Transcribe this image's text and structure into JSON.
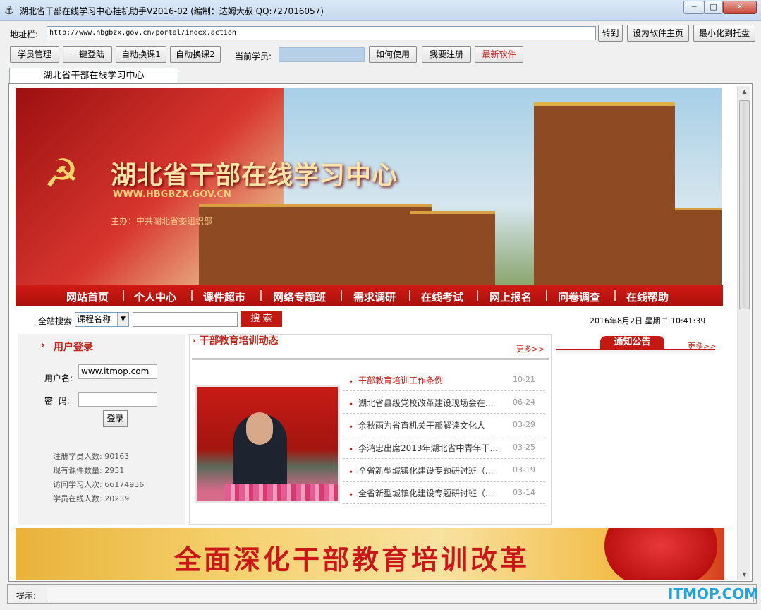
{
  "window": {
    "title": "湖北省干部在线学习中心挂机助手V2016-02 (编制：达姆大叔 QQ:727016057)",
    "minimize": "─",
    "maximize": "□",
    "close": "✕"
  },
  "toolbar": {
    "address_label": "地址栏:",
    "address_value": "http://www.hbgbzx.gov.cn/portal/index.action",
    "go_label": "转到",
    "set_home_label": "设为软件主页",
    "minimize_tray_label": "最小化到托盘",
    "student_mgmt_label": "学员管理",
    "one_click_login_label": "一键登陆",
    "auto_switch1_label": "自动换课1",
    "auto_switch2_label": "自动换课2",
    "current_student_label": "当前学员:",
    "how_to_use_label": "如何使用",
    "register_label": "我要注册",
    "latest_software_label": "最新软件"
  },
  "tab": {
    "label": "湖北省干部在线学习中心"
  },
  "site": {
    "banner": {
      "title": "湖北省干部在线学习中心",
      "url": "WWW.HBGBZX.GOV.CN",
      "sponsor": "主办：中共湖北省委组织部"
    },
    "nav": [
      "网站首页",
      "个人中心",
      "课件超市",
      "网络专题班",
      "需求调研",
      "在线考试",
      "网上报名",
      "问卷调查",
      "在线帮助"
    ],
    "search": {
      "label": "全站搜索",
      "select_value": "课程名称",
      "button": "搜 索"
    },
    "date": "2016年8月2日 星期二 10:41:39",
    "login": {
      "title": "用户登录",
      "username_label": "用户名:",
      "username_value": "www.itmop.com",
      "password_label": "密  码:",
      "submit": "登录"
    },
    "stats": [
      {
        "label": "注册学员人数:",
        "value": "90163"
      },
      {
        "label": "现有课件数量:",
        "value": "2931"
      },
      {
        "label": "访问学习人次:",
        "value": "66174936"
      },
      {
        "label": "学员在线人数:",
        "value": "20239"
      }
    ],
    "news": {
      "title": "干部教育培训动态",
      "more": "更多>>",
      "items": [
        {
          "title": "干部教育培训工作条例",
          "date": "10-21"
        },
        {
          "title": "湖北省县级党校改革建设现场会在...",
          "date": "06-24"
        },
        {
          "title": "余秋雨为省直机关干部解读文化人",
          "date": "03-29"
        },
        {
          "title": "李鸿忠出席2013年湖北省中青年干...",
          "date": "03-25"
        },
        {
          "title": "全省新型城镇化建设专题研讨班（...",
          "date": "03-19"
        },
        {
          "title": "全省新型城镇化建设专题研讨班（...",
          "date": "03-14"
        }
      ]
    },
    "notice": {
      "title": "通知公告",
      "more": "更多>>"
    },
    "bottom_slogan": "全面深化干部教育培训改革"
  },
  "status": {
    "hint_label": "提示:"
  },
  "watermark": "ITMOP.COM"
}
